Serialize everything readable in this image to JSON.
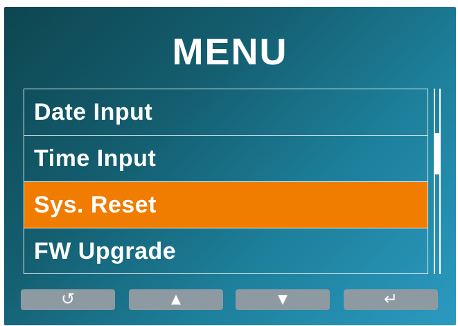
{
  "title": "MENU",
  "menu": {
    "items": [
      {
        "label": "Date Input"
      },
      {
        "label": "Time Input"
      },
      {
        "label": "Sys. Reset"
      },
      {
        "label": "FW Upgrade"
      }
    ],
    "selected_index": 2
  },
  "buttons": [
    {
      "icon": "back-icon",
      "glyph": "↺"
    },
    {
      "icon": "up-arrow-icon",
      "glyph": "▲"
    },
    {
      "icon": "down-arrow-icon",
      "glyph": "▼"
    },
    {
      "icon": "enter-icon",
      "glyph": "↵"
    }
  ],
  "colors": {
    "background_dark": "#0d4650",
    "background_light": "#2b9ac0",
    "highlight": "#f07c00",
    "button": "#8e9aa2"
  }
}
